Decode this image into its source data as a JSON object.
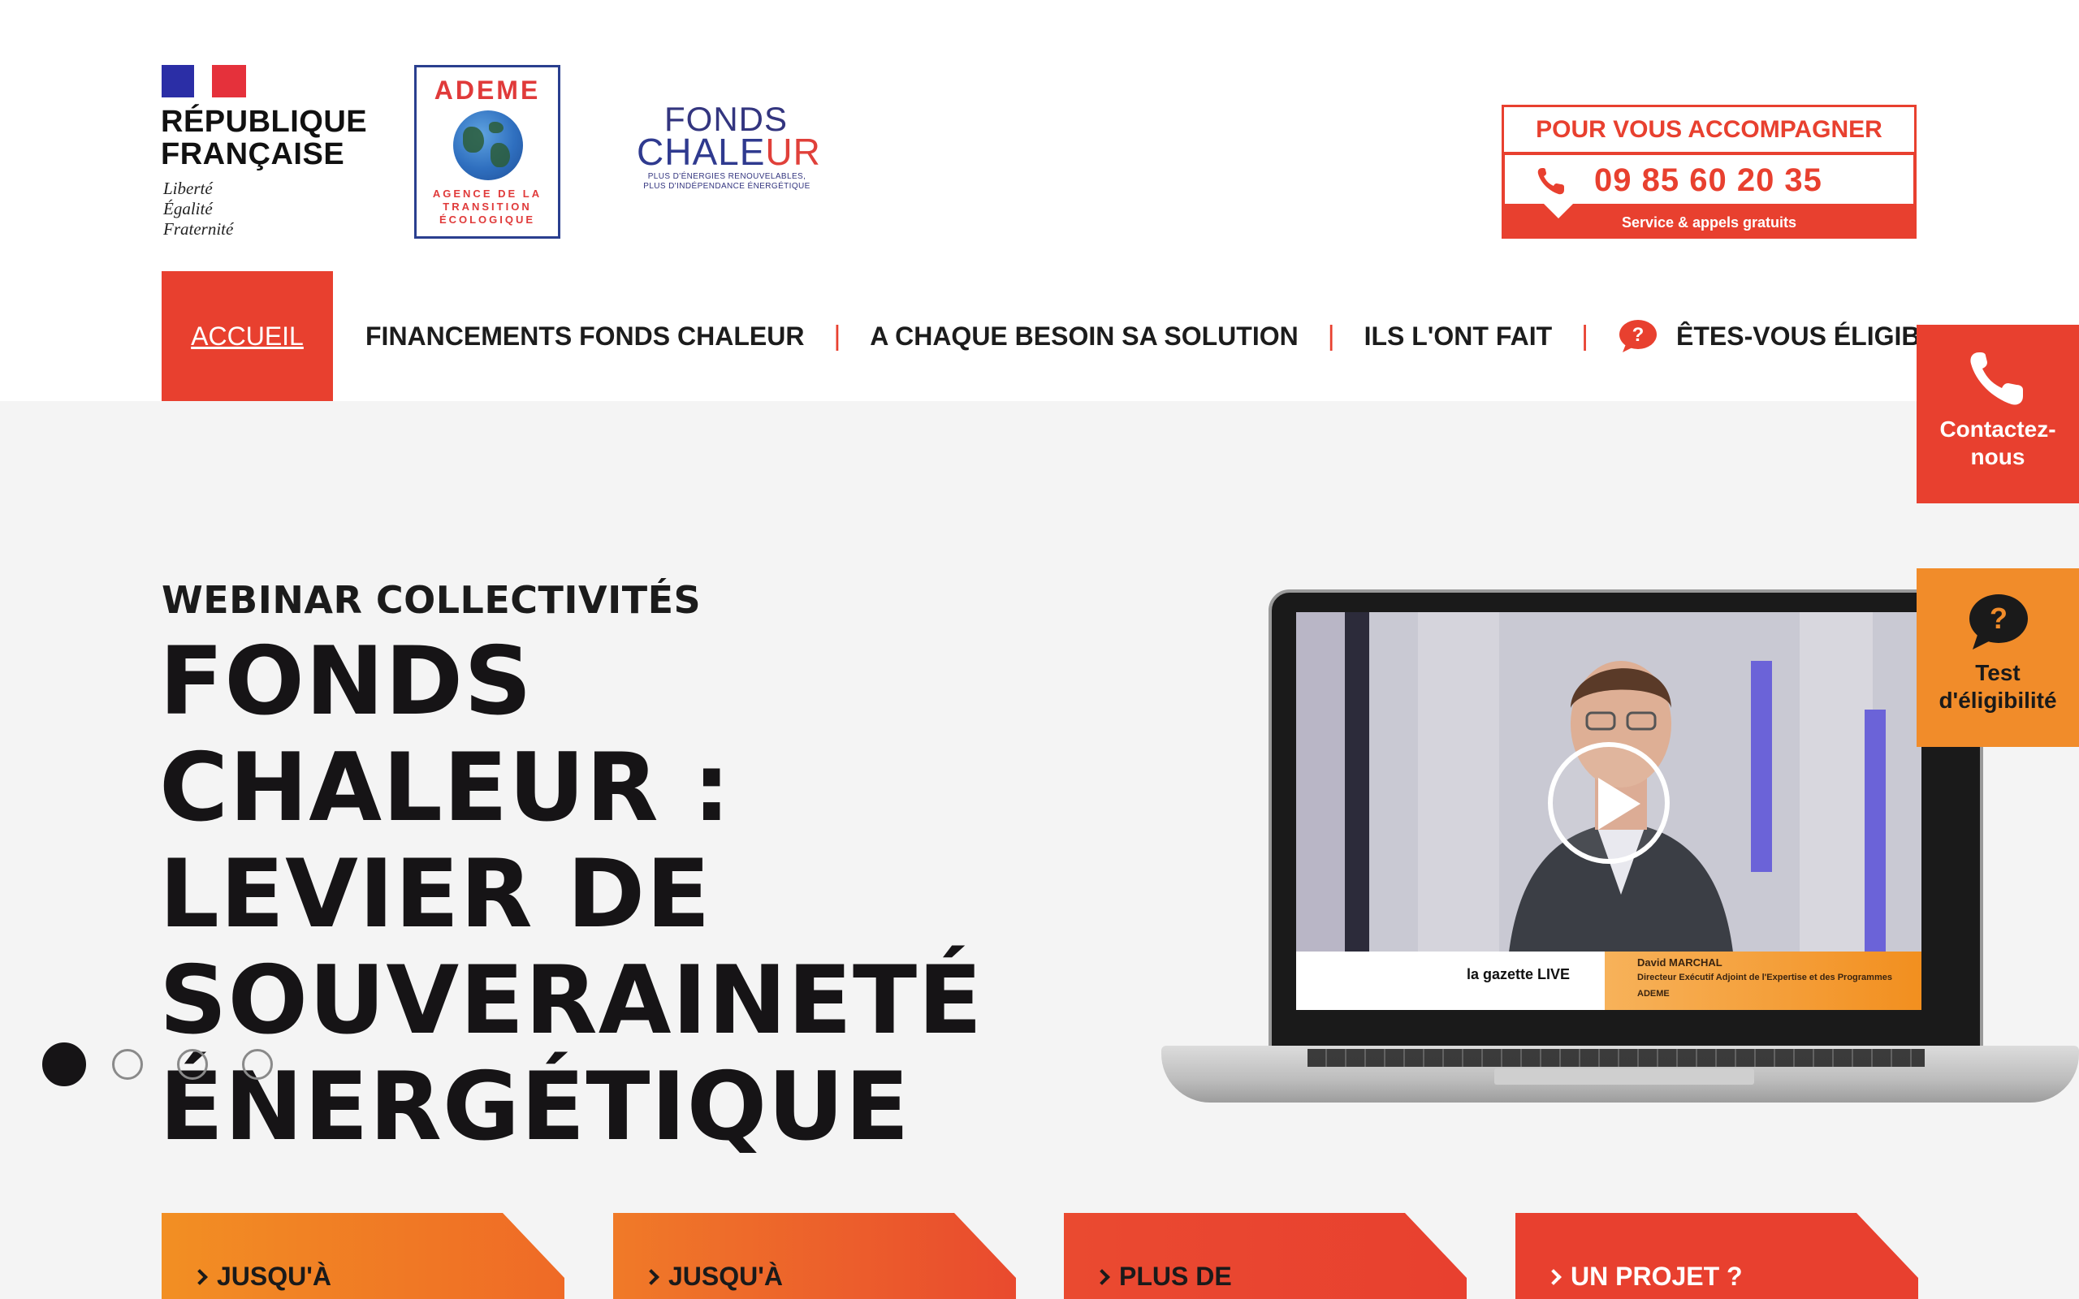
{
  "header": {
    "republique": {
      "name_line1": "RÉPUBLIQUE",
      "name_line2": "FRANÇAISE",
      "motto": [
        "Liberté",
        "Égalité",
        "Fraternité"
      ]
    },
    "ademe": {
      "name": "ADEME",
      "subtitle_lines": [
        "AGENCE DE LA",
        "TRANSITION",
        "ÉCOLOGIQUE"
      ]
    },
    "fonds_chaleur": {
      "line1": "FONDS",
      "line2_a": "CHALE",
      "line2_b": "UR",
      "tagline_1": "PLUS D'ÉNERGIES RENOUVELABLES,",
      "tagline_2": "PLUS D'INDÉPENDANCE ÉNERGÉTIQUE"
    },
    "contact": {
      "title": "POUR VOUS ACCOMPAGNER",
      "phone": "09 85 60 20 35",
      "note": "Service & appels gratuits"
    }
  },
  "nav": {
    "items": [
      {
        "label": "ACCUEIL",
        "active": true
      },
      {
        "label": "FINANCEMENTS FONDS CHALEUR"
      },
      {
        "label": "A CHAQUE BESOIN SA SOLUTION"
      },
      {
        "label": "ILS L'ONT FAIT"
      },
      {
        "label": "ÊTES-VOUS ÉLIGIBLE ?",
        "icon": "question-bubble-icon"
      }
    ],
    "separator": "|"
  },
  "hero": {
    "kicker": "WEBINAR COLLECTIVITÉS",
    "title_lines": [
      "FONDS",
      "CHALEUR :",
      "LEVIER DE",
      "SOUVERAINETÉ",
      "ÉNERGÉTIQUE"
    ],
    "slides_count": 4,
    "active_slide": 1,
    "video": {
      "speaker_name": "David MARCHAL",
      "speaker_role": "Directeur Exécutif Adjoint de l'Expertise et des Programmes",
      "speaker_org": "ADEME",
      "partner": "la gazette LIVE"
    }
  },
  "side_buttons": {
    "contact": {
      "label_1": "Contactez-",
      "label_2": "nous",
      "icon": "phone-icon"
    },
    "test": {
      "label_1": "Test",
      "label_2": "d'éligibilité",
      "icon": "question-bubble-icon"
    }
  },
  "cards": [
    {
      "label": "JUSQU'À"
    },
    {
      "label": "JUSQU'À"
    },
    {
      "label": "PLUS DE"
    },
    {
      "label": "UN PROJET ?"
    }
  ],
  "colors": {
    "accent_red": "#e8402f",
    "accent_orange": "#f18c2a",
    "navy": "#2a3f8f",
    "hero_bg": "#f4f4f4",
    "title_dark": "#161416"
  }
}
